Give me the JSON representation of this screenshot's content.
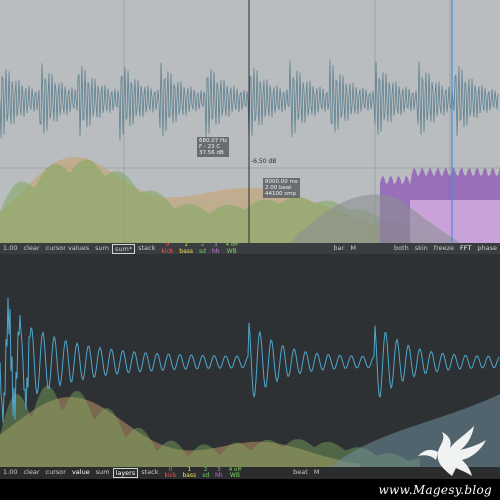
{
  "top": {
    "db_label": "-6.50 dB",
    "cursor_readout": [
      "680.07 Hz",
      "F - 23 C",
      "37.56 dB"
    ],
    "beat_readout": [
      "8000.00 ms",
      "2.00 beat",
      "44100 smp"
    ],
    "toolbar": {
      "zoom": "1.00",
      "clear": "clear",
      "cursor_values": "cursor values",
      "sum": "sum",
      "sum_star": "sum*",
      "stack": "stack",
      "layers": [
        {
          "num": "0",
          "label": "kick",
          "color": "#ff5a5a"
        },
        {
          "num": "1",
          "label": "bass",
          "color": "#f2e24a"
        },
        {
          "num": "2",
          "label": "sd",
          "color": "#6ad06a"
        },
        {
          "num": "3",
          "label": "hh",
          "color": "#c77be0"
        },
        {
          "num": "4 off",
          "label": "WB",
          "color": "#7ed957"
        }
      ],
      "bar": "bar",
      "m": "M",
      "both": "both",
      "skin": "skin",
      "freeze": "freeze",
      "fft": "FFT",
      "phase": "phase"
    }
  },
  "bottom": {
    "toolbar": {
      "zoom": "1.00",
      "clear": "clear",
      "cursor": "cursor",
      "value": "value",
      "sum": "sum",
      "layers": "layers",
      "stack": "stack",
      "layer_items": [
        {
          "num": "0",
          "label": "kick",
          "color": "#ff5a5a"
        },
        {
          "num": "1",
          "label": "bass",
          "color": "#f2e24a"
        },
        {
          "num": "2",
          "label": "sd",
          "color": "#6ad06a"
        },
        {
          "num": "3",
          "label": "hh",
          "color": "#c77be0"
        },
        {
          "num": "4 off",
          "label": "WB",
          "color": "#7ed957"
        }
      ],
      "beat": "beat",
      "m": "M"
    }
  },
  "watermark": "www.Magesy.blog",
  "colors": {
    "top_bg": "#b9bdbf",
    "bottom_bg": "#2e3134",
    "waveform_top": "#5f8190",
    "waveform_bottom": "#4fa7cc",
    "spectrum_green": "#7da85f",
    "spectrum_orange": "#c7a06a",
    "spectrum_purple": "#8d55b5",
    "cursor_line": "#4a8fe0"
  }
}
